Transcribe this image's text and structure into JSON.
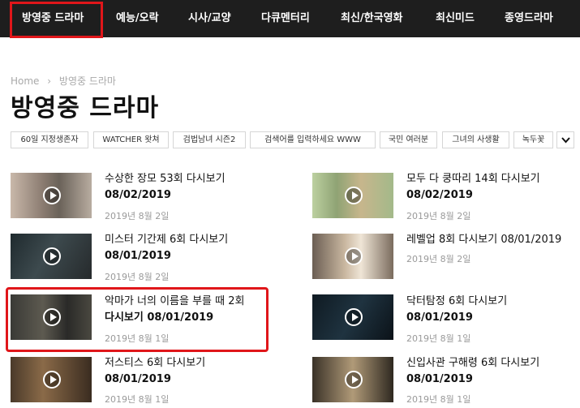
{
  "nav": {
    "items": [
      "방영중 드라마",
      "예능/오락",
      "시사/교양",
      "다큐멘터리",
      "최신/한국영화",
      "최신미드",
      "종영드라마"
    ],
    "active_index": 0
  },
  "breadcrumb": {
    "home": "Home",
    "separator": "›",
    "current": "방영중 드라마"
  },
  "page_title": "방영중 드라마",
  "tags": [
    "60일 지정생존자",
    "WATCHER 왓쳐",
    "검법남녀 시즌2",
    "검색어를 입력하세요 WWW",
    "국민 여러분",
    "그녀의 사생활",
    "녹두꽃"
  ],
  "tags_toggle_icon": "chevron-down-icon",
  "posts": [
    {
      "title_line1": "수상한 장모 53회 다시보기",
      "title_line2": "08/02/2019",
      "date": "2019년 8월 2일"
    },
    {
      "title_line1": "모두 다 쿵따리 14회 다시보기",
      "title_line2": "08/02/2019",
      "date": "2019년 8월 2일"
    },
    {
      "title_line1": "미스터 기간제 6회 다시보기",
      "title_line2": "08/01/2019",
      "date": "2019년 8월 2일"
    },
    {
      "title_line1": "레벨업 8회 다시보기 08/01/2019",
      "title_line2": "",
      "date": "2019년 8월 2일"
    },
    {
      "title_line1": "악마가 너의 이름을 부를 때 2회",
      "title_line2": "다시보기 08/01/2019",
      "date": "2019년 8월 1일"
    },
    {
      "title_line1": "닥터탐정 6회 다시보기",
      "title_line2": "08/01/2019",
      "date": "2019년 8월 1일"
    },
    {
      "title_line1": "저스티스 6회 다시보기",
      "title_line2": "08/01/2019",
      "date": "2019년 8월 1일"
    },
    {
      "title_line1": "신입사관 구해령 6회 다시보기",
      "title_line2": "08/01/2019",
      "date": "2019년 8월 1일"
    }
  ],
  "colors": {
    "nav_bg": "#1e1e1e",
    "highlight": "#e0161a",
    "muted": "#9a9a9a"
  }
}
